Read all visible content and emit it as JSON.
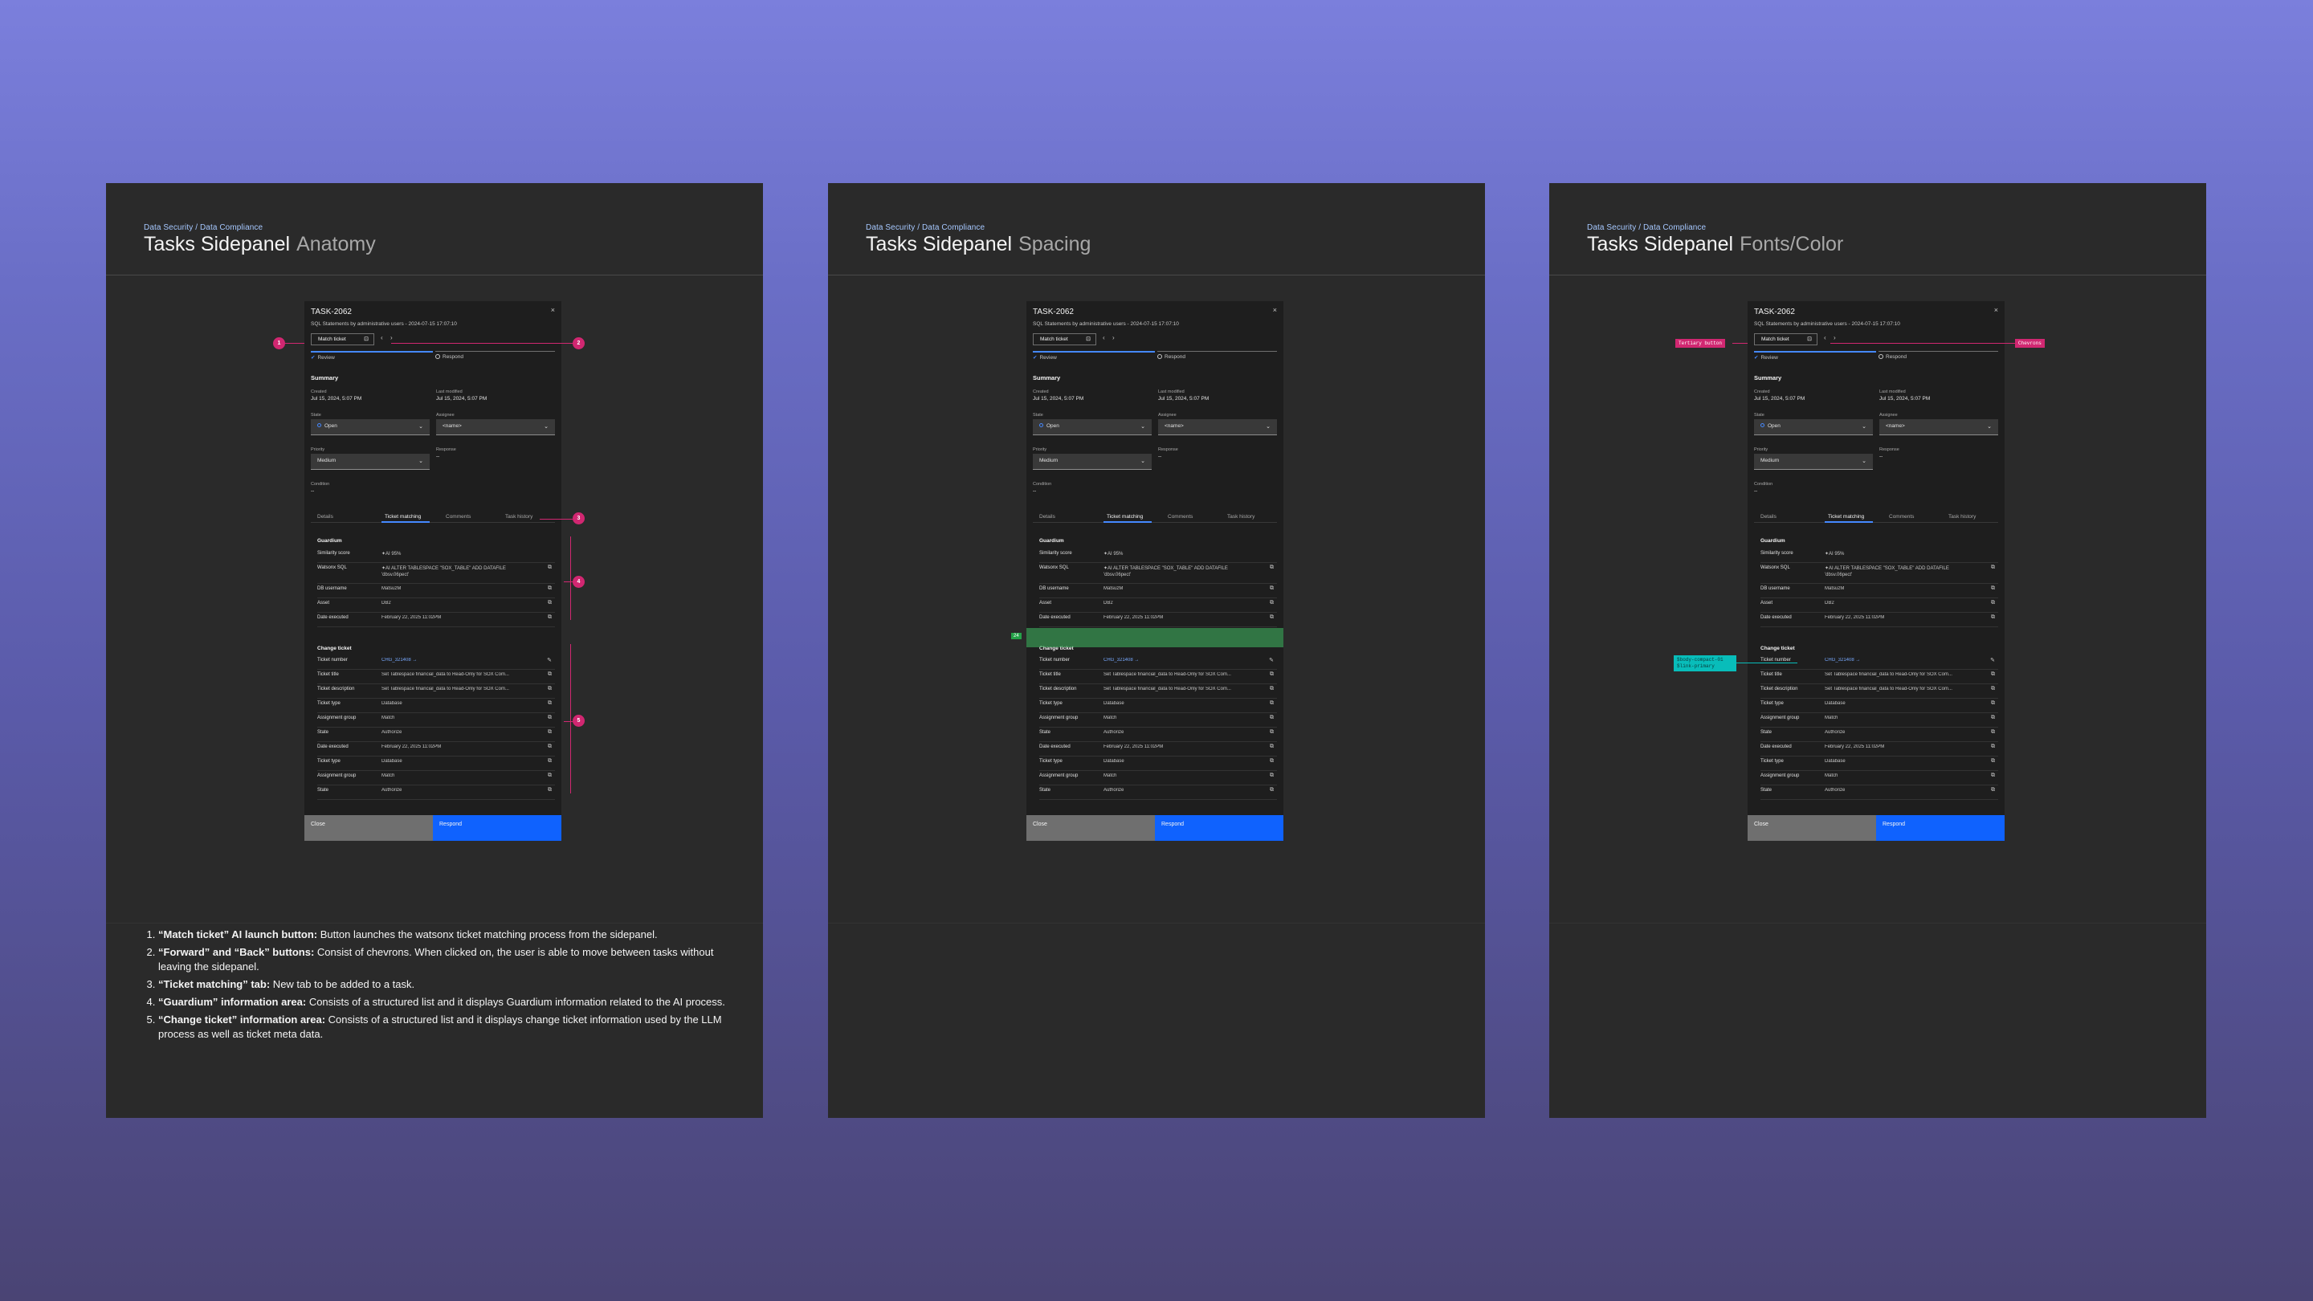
{
  "boards": [
    {
      "breadcrumb": "Data Security / Data Compliance",
      "title": "Tasks Sidepanel",
      "subtitle": "Anatomy"
    },
    {
      "breadcrumb": "Data Security / Data Compliance",
      "title": "Tasks Sidepanel",
      "subtitle": "Spacing"
    },
    {
      "breadcrumb": "Data Security / Data Compliance",
      "title": "Tasks Sidepanel",
      "subtitle": "Fonts/Color"
    }
  ],
  "panel": {
    "task_id": "TASK-2062",
    "close_icon": "×",
    "description": "SQL Statements by administrative users - 2024-07-15 17:07:10",
    "match_button": "Match ticket",
    "match_icon": "ai-launch-icon",
    "back_chevron": "‹",
    "forward_chevron": "›",
    "steps": [
      {
        "label": "Review"
      },
      {
        "label": "Respond"
      }
    ],
    "summary_title": "Summary",
    "created_label": "Created",
    "created_value": "Jul 15, 2024, 5:07 PM",
    "modified_label": "Last modified",
    "modified_value": "Jul 15, 2024, 5:07 PM",
    "state_label": "State",
    "state_value": "Open",
    "assignee_label": "Assignee",
    "assignee_value": "<name>",
    "priority_label": "Priority",
    "priority_value": "Medium",
    "response_label": "Response",
    "response_value": "--",
    "condition_label": "Condition",
    "condition_value": "--",
    "tabs": [
      "Details",
      "Ticket matching",
      "Comments",
      "Task history"
    ],
    "guardium_title": "Guardium",
    "guardium_rows": [
      {
        "k": "Similarity score",
        "v": "✦AI  95%"
      },
      {
        "k": "Watsonx SQL",
        "v": "✦AI  ALTER TABLESPACE \"SOX_TABLE\" ADD DATAFILE 'dbsv.06pect'"
      },
      {
        "k": "DB username",
        "v": "MatsuzM"
      },
      {
        "k": "Asset",
        "v": "DB2"
      },
      {
        "k": "Date executed",
        "v": "February 22, 2025 11:02PM"
      }
    ],
    "change_title": "Change ticket",
    "change_rows": [
      {
        "k": "Ticket number",
        "v": "CHG_321408  →",
        "link": true
      },
      {
        "k": "Ticket title",
        "v": "Set Tablespace financial_data to Read-Only for SOX Com..."
      },
      {
        "k": "Ticket description",
        "v": "Set Tablespace financial_data to Read-Only for SOX Com..."
      },
      {
        "k": "Ticket type",
        "v": "Database"
      },
      {
        "k": "Assignment group",
        "v": "Match"
      },
      {
        "k": "State",
        "v": "Authorize"
      },
      {
        "k": "Date executed",
        "v": "February 22, 2025 11:02PM"
      },
      {
        "k": "Ticket type",
        "v": "Database"
      },
      {
        "k": "Assignment group",
        "v": "Match"
      },
      {
        "k": "State",
        "v": "Authorize"
      }
    ],
    "close_button": "Close",
    "respond_button": "Respond"
  },
  "callouts": [
    "1",
    "2",
    "3",
    "4",
    "5"
  ],
  "spacing_tag": "24",
  "font_tags": {
    "tertiary": "Tertiary button",
    "chevrons": "Chevrons",
    "body": "$body-compact-01 $link-primary"
  },
  "notes": [
    {
      "term": "“Match ticket” AI launch button:",
      "text": " Button launches the watsonx ticket matching process from the sidepanel."
    },
    {
      "term": "“Forward” and “Back” buttons:",
      "text": " Consist of chevrons. When clicked on, the user is able to move between tasks without leaving the sidepanel."
    },
    {
      "term": "“Ticket matching” tab:",
      "text": " New tab to be added to a task."
    },
    {
      "term": "“Guardium” information area:",
      "text": " Consists of a structured list and it displays Guardium information related to the AI process."
    },
    {
      "term": "“Change ticket” information area:",
      "text": " Consists of a structured list and it displays change ticket information used by the LLM process as well as ticket meta data."
    }
  ],
  "colors": {
    "accent": "#0f62fe",
    "callout": "#d12771",
    "spacing": "#42be65",
    "link": "#78a9ff"
  }
}
